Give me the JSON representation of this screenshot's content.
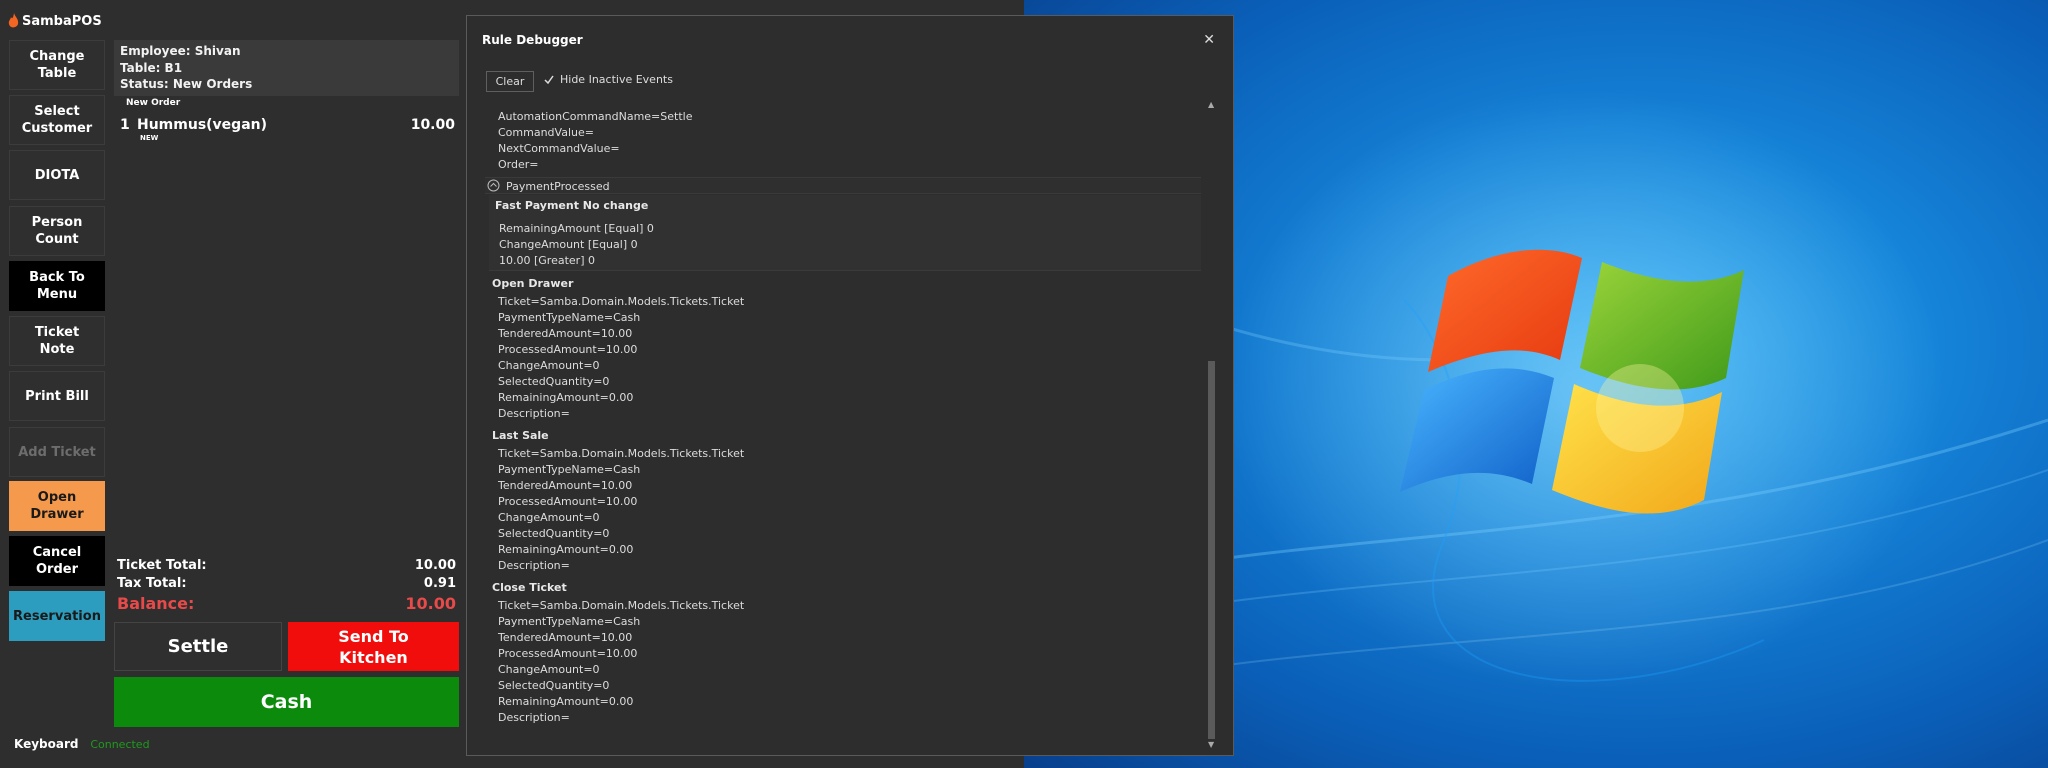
{
  "app": {
    "title": "SambaPOS"
  },
  "left_buttons": [
    {
      "label": "Change\nTable",
      "style": "normal"
    },
    {
      "label": "Select\nCustomer",
      "style": "normal"
    },
    {
      "label": "DIOTA",
      "style": "normal"
    },
    {
      "label": "Person\nCount",
      "style": "normal"
    },
    {
      "label": "Back To\nMenu",
      "style": "black"
    },
    {
      "label": "Ticket\nNote",
      "style": "normal"
    },
    {
      "label": "Print Bill",
      "style": "normal"
    },
    {
      "label": "Add Ticket",
      "style": "disabled"
    },
    {
      "label": "Open\nDrawer",
      "style": "orange"
    },
    {
      "label": "Cancel Order",
      "style": "black"
    },
    {
      "label": "Reservation",
      "style": "teal"
    }
  ],
  "ticket": {
    "employee": "Employee: Shivan",
    "table": "Table: B1",
    "status": "Status: New Orders",
    "section_label": "New Order",
    "orders": [
      {
        "qty": "1",
        "name": "Hummus(vegan)",
        "price": "10.00",
        "tag": "NEW"
      }
    ],
    "totals": {
      "ticket_total_label": "Ticket Total:",
      "ticket_total": "10.00",
      "tax_total_label": "Tax Total:",
      "tax_total": "0.91",
      "balance_label": "Balance:",
      "balance": "10.00"
    }
  },
  "actions": {
    "settle": "Settle",
    "send_to_kitchen": "Send To\nKitchen",
    "cash": "Cash"
  },
  "status_bar": {
    "keyboard": "Keyboard",
    "connection": "Connected"
  },
  "colors": {
    "balance": "#e84a4a",
    "send_to_kitchen": "#f20d0d",
    "cash": "#0b8a0b",
    "open_drawer": "#f59a4c",
    "reservation": "#2d9dbf",
    "connected": "#1e9a1e"
  },
  "dialog": {
    "title": "Rule Debugger",
    "close_icon": "close-icon",
    "clear_label": "Clear",
    "hide_inactive_label": "Hide Inactive Events",
    "hide_inactive_checked": true,
    "log": {
      "top_lines": [
        "AutomationCommandName=Settle",
        "CommandValue=",
        "NextCommandValue=",
        "Order="
      ],
      "event_name": "PaymentProcessed",
      "rule_name": "Fast Payment No change",
      "constraints": [
        "RemainingAmount [Equal] 0",
        "ChangeAmount [Equal] 0",
        "10.00 [Greater] 0"
      ],
      "actions": [
        {
          "name": "Open Drawer",
          "params": [
            "Ticket=Samba.Domain.Models.Tickets.Ticket",
            "PaymentTypeName=Cash",
            "TenderedAmount=10.00",
            "ProcessedAmount=10.00",
            "ChangeAmount=0",
            "SelectedQuantity=0",
            "RemainingAmount=0.00",
            "Description="
          ]
        },
        {
          "name": "Last Sale",
          "params": [
            "Ticket=Samba.Domain.Models.Tickets.Ticket",
            "PaymentTypeName=Cash",
            "TenderedAmount=10.00",
            "ProcessedAmount=10.00",
            "ChangeAmount=0",
            "SelectedQuantity=0",
            "RemainingAmount=0.00",
            "Description="
          ]
        },
        {
          "name": "Close Ticket",
          "params": [
            "Ticket=Samba.Domain.Models.Tickets.Ticket",
            "PaymentTypeName=Cash",
            "TenderedAmount=10.00",
            "ProcessedAmount=10.00",
            "ChangeAmount=0",
            "SelectedQuantity=0",
            "RemainingAmount=0.00",
            "Description="
          ]
        }
      ]
    }
  }
}
